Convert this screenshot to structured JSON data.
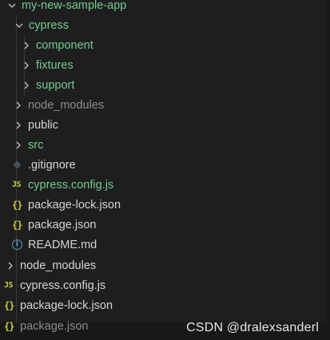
{
  "tree": {
    "root": {
      "label": "my-new-sample-app"
    },
    "cypress": {
      "label": "cypress"
    },
    "component": {
      "label": "component"
    },
    "fixtures": {
      "label": "fixtures"
    },
    "support": {
      "label": "support"
    },
    "node_modules": {
      "label": "node_modules"
    },
    "public": {
      "label": "public"
    },
    "src": {
      "label": "src"
    },
    "gitignore": {
      "label": ".gitignore"
    },
    "cypress_config": {
      "label": "cypress.config.js",
      "icon_text": "JS"
    },
    "package_lock": {
      "label": "package-lock.json",
      "icon_text": "{}"
    },
    "package_json": {
      "label": "package.json",
      "icon_text": "{}"
    },
    "readme": {
      "label": "README.md",
      "icon_text": "i"
    }
  },
  "outer": {
    "node_modules": {
      "label": "node_modules"
    },
    "cypress_config": {
      "label": "cypress.config.js",
      "icon_text": "JS"
    },
    "package_lock": {
      "label": "package-lock.json",
      "icon_text": "{}"
    },
    "package_json": {
      "label": "package.json",
      "icon_text": "{}"
    }
  },
  "watermark": "CSDN @dralexsanderl",
  "colors": {
    "modified_green": "#73c991",
    "ignored_gray": "#8c8c8c",
    "json_yellow": "#cbcb41",
    "info_blue": "#519aba",
    "background": "#181818"
  }
}
